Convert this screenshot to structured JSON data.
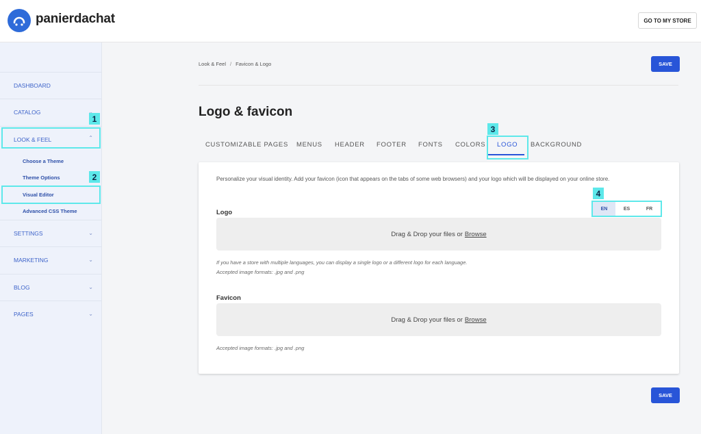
{
  "header": {
    "brand": "panierdachat",
    "store_button": "GO TO MY STORE"
  },
  "sidebar": {
    "items": [
      {
        "label": "DASHBOARD"
      },
      {
        "label": "CATALOG"
      },
      {
        "label": "LOOK & FEEL"
      },
      {
        "label": "SETTINGS"
      },
      {
        "label": "MARKETING"
      },
      {
        "label": "BLOG"
      },
      {
        "label": "PAGES"
      }
    ],
    "subitems": [
      {
        "label": "Choose a Theme"
      },
      {
        "label": "Theme Options"
      },
      {
        "label": "Visual Editor"
      },
      {
        "label": "Advanced CSS Theme"
      }
    ]
  },
  "breadcrumb": {
    "parent": "Look & Feel",
    "separator": "/",
    "current": "Favicon & Logo"
  },
  "save_label": "SAVE",
  "page_title": "Logo & favicon",
  "tabs": [
    {
      "label": "CUSTOMIZABLE PAGES"
    },
    {
      "label": "MENUS"
    },
    {
      "label": "HEADER"
    },
    {
      "label": "FOOTER"
    },
    {
      "label": "FONTS"
    },
    {
      "label": "COLORS"
    },
    {
      "label": "LOGO"
    },
    {
      "label": "BACKGROUND"
    }
  ],
  "content": {
    "intro": "Personalize your visual identity. Add your favicon (icon that appears on the tabs of some web browsers) and your logo which will be displayed on your online store.",
    "logo": {
      "label": "Logo",
      "drop_text": "Drag & Drop your files or",
      "browse": "Browse",
      "hint1": "If you have a store with multiple languages, you can display a single logo or a different logo for each language.",
      "hint2": "Accepted image formats: .jpg and .png"
    },
    "favicon": {
      "label": "Favicon",
      "drop_text": "Drag & Drop your files or",
      "browse": "Browse",
      "hint": "Accepted image formats: .jpg and .png"
    },
    "languages": [
      {
        "code": "EN",
        "selected": true
      },
      {
        "code": "ES",
        "selected": false
      },
      {
        "code": "FR",
        "selected": false
      }
    ]
  },
  "annotations": [
    "1",
    "2",
    "3",
    "4"
  ],
  "colors": {
    "accent": "#2855d8",
    "annotation": "#5de8ea",
    "sidebar_bg": "#eef2fb"
  }
}
